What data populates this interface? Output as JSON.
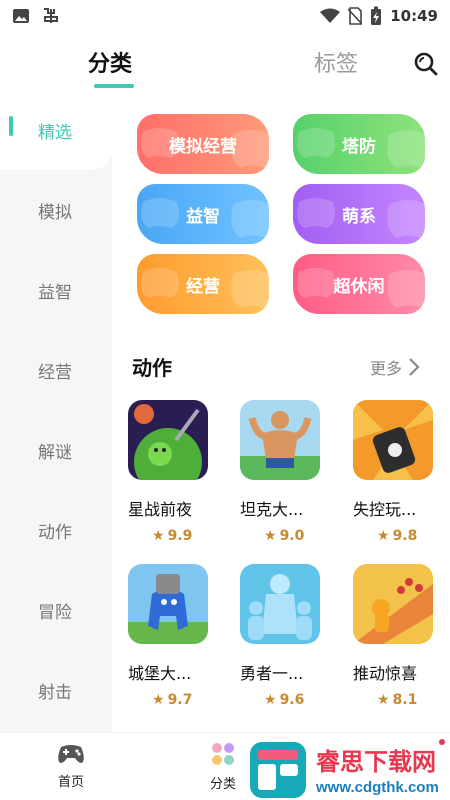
{
  "status_bar": {
    "time": "10:49"
  },
  "header": {
    "tabs": [
      {
        "label": "分类",
        "active": true
      },
      {
        "label": "标签",
        "active": false
      }
    ]
  },
  "sidebar": {
    "items": [
      {
        "label": "精选",
        "active": true
      },
      {
        "label": "模拟"
      },
      {
        "label": "益智"
      },
      {
        "label": "经营"
      },
      {
        "label": "解谜"
      },
      {
        "label": "动作"
      },
      {
        "label": "冒险"
      },
      {
        "label": "射击"
      }
    ]
  },
  "tags": [
    {
      "label": "模拟经营",
      "color_from": "#ff6f6a",
      "color_to": "#ff9a78"
    },
    {
      "label": "塔防",
      "color_from": "#56d16a",
      "color_to": "#8ee37b"
    },
    {
      "label": "益智",
      "color_from": "#4aa6f5",
      "color_to": "#6fc3ff"
    },
    {
      "label": "萌系",
      "color_from": "#a35ef2",
      "color_to": "#c585ff"
    },
    {
      "label": "经营",
      "color_from": "#ff9b2f",
      "color_to": "#ffc15a"
    },
    {
      "label": "超休闲",
      "color_from": "#ff5c86",
      "color_to": "#ff8aa8"
    }
  ],
  "section": {
    "title": "动作",
    "more_label": "更多"
  },
  "games": [
    {
      "name": "星战前夜",
      "rating": "9.9"
    },
    {
      "name": "坦克大...",
      "rating": "9.0"
    },
    {
      "name": "失控玩...",
      "rating": "9.8"
    },
    {
      "name": "城堡大...",
      "rating": "9.7"
    },
    {
      "name": "勇者一...",
      "rating": "9.6"
    },
    {
      "name": "推动惊喜",
      "rating": "8.1"
    }
  ],
  "bottom_nav": {
    "items": [
      {
        "label": "首页",
        "icon": "gamepad-icon"
      },
      {
        "label": "分类",
        "icon": "category-dots-icon"
      }
    ]
  },
  "watermark": {
    "text": "睿思下载网",
    "url": "www.cdgthk.com"
  },
  "colors": {
    "accent": "#3ec9b6",
    "rating": "#c98a2e"
  }
}
